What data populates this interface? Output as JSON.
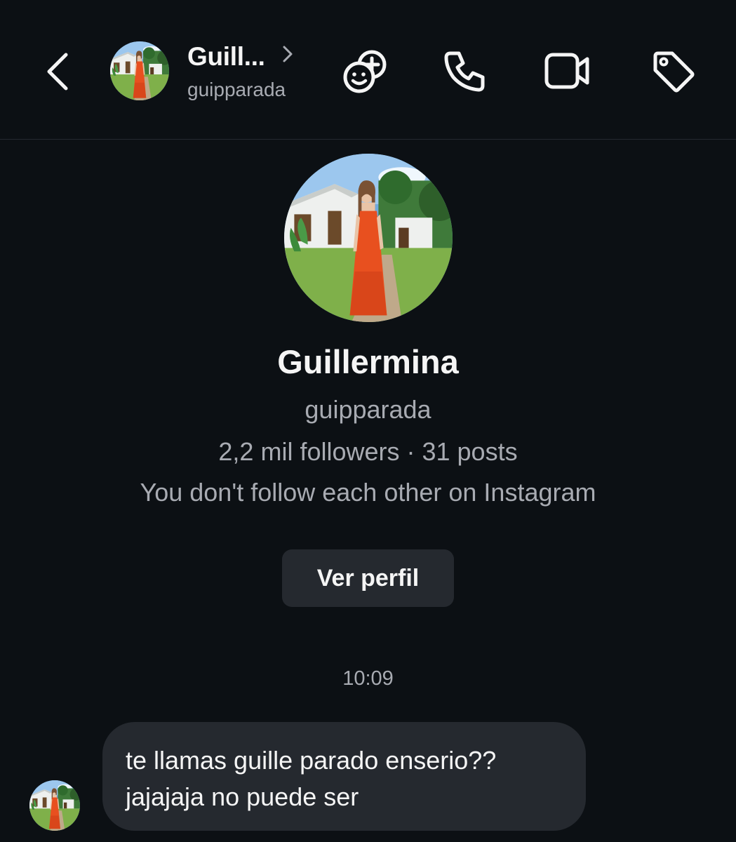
{
  "header": {
    "display_name": "Guill...",
    "username": "guipparada",
    "icons": {
      "back": "chevron-left-icon",
      "details": "chevron-right-icon",
      "add_friends": "friends-plus-icon",
      "call": "phone-icon",
      "video": "video-camera-icon",
      "tag": "tag-icon"
    }
  },
  "profile": {
    "name": "Guillermina",
    "username": "guipparada",
    "stats": "2,2 mil followers · 31 posts",
    "mutual": "You don't follow each other on Instagram",
    "view_button_label": "Ver perfil"
  },
  "thread": {
    "timestamp": "10:09",
    "messages": [
      {
        "from": "other",
        "lines": [
          "te llamas guille parado enserio??",
          "jajajaja no puede ser"
        ]
      }
    ]
  },
  "colors": {
    "background": "#0c1014",
    "bubble": "#25292f",
    "primary_text": "#f5f5f5",
    "secondary_text": "#a8abb2",
    "dress": "#e8501f"
  }
}
